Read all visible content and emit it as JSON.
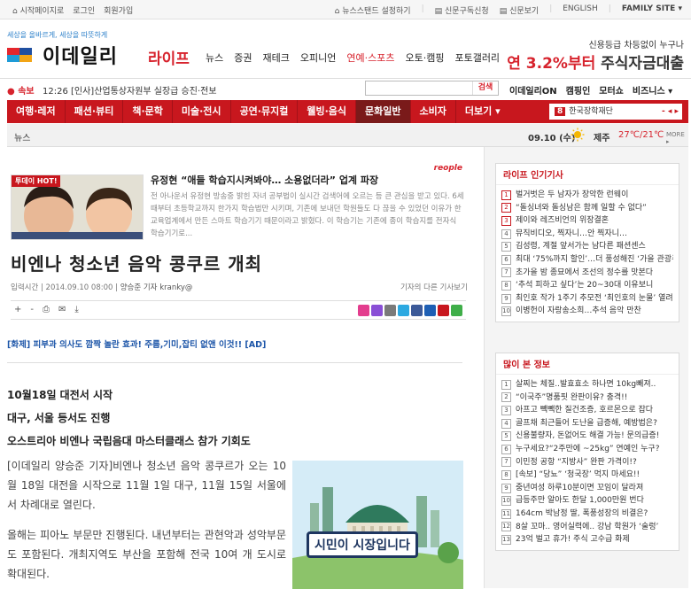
{
  "topbar": {
    "home": "시작페이지로",
    "login": "로그인",
    "join": "회원가입",
    "newsstand": "뉴스스탠드 설정하기",
    "subscribe": "신문구독신청",
    "paper": "신문보기",
    "english": "ENGLISH",
    "family": "FAMILY SITE"
  },
  "header": {
    "slogan": "세상을 올바르게, 세상을 따뜻하게",
    "logo": "이데일리",
    "section": "라이프",
    "nav": [
      "뉴스",
      "증권",
      "재테크",
      "오피니언",
      "연예·스포츠",
      "오토·캠핑",
      "포토갤러리"
    ],
    "ad_line1": "신용등급 차등없이 누구나",
    "ad_line2a": "연 3.2%부터",
    "ad_line2b": " 주식자금대출"
  },
  "ticker": {
    "tag": "속보",
    "text": "12:26 [인사]산업통상자원부 실장급 승진·전보",
    "search_placeholder": "",
    "search_btn": "검색",
    "links": [
      "이데일리ON",
      "캠핑인",
      "모터쇼",
      "비즈니스"
    ]
  },
  "categories": [
    "여행·레저",
    "패션·뷰티",
    "책·문학",
    "미술·전시",
    "공연·뮤지컬",
    "웰빙·음식",
    "문화일반",
    "소비자"
  ],
  "categories_more": "더보기",
  "rank_num": "8",
  "rank_text": "한국장학재단",
  "rank_ctl": "- ◂ ▸",
  "subbar": {
    "crumb": "뉴스",
    "date": "09.10 (수)",
    "city": "제주",
    "temp": "27℃/21℃",
    "more": "MORE ▸"
  },
  "hot": {
    "label": "투데이 HOT!",
    "headline": "유정현 “애들 학습지시켜봐야… 소용없더라” 업계 파장",
    "summary": "전 아나운서 유정현 방송중 밝힌 자녀 공부법이 실시간 검색어에 오르는 등 큰 관심을 받고 있다. 6세 때부터 초등학교까지 한가지 학습법만 시키며, 기존에 보내던 학원들도 다 끊을 수 있었던 이유가 한 교육업계에서 만든 스마트 학습기기 때문이라고 밝혔다. 이 학습기는 기존에 종이 학습지를 전자식 학습기기로...",
    "brand": "reople"
  },
  "article": {
    "title": "비엔나 청소년 음악 콩쿠르 개최",
    "meta": "입력시간 | 2014.09.10 08:00 | ",
    "author": "양승준 기자 kranky@",
    "other": "기자의 다른 기사보기",
    "tools": [
      "+",
      "-",
      "⎙",
      "✉",
      "⤓"
    ],
    "ad": "[화제] 피부과 의사도 깜짝 놀란 효과! 주름,기미,잡티 없앤 이것!! [AD]",
    "subheads": [
      "10월18일 대전서 시작",
      "대구, 서울 등서도 진행",
      "오스트리아 비엔나 국립음대 마스터클래스 참가 기회도"
    ],
    "p1": "[이데일리 양승준 기자]비엔나 청소년 음악 콩쿠르가 오는 10월 18일 대전을 시작으로 11월 1일 대구, 11월 15일 서울에서 차례대로 열린다.",
    "p2": "올해는 피아노 부문만 진행된다. 내년부터는 관현악과 성악부문도 포함된다. 개최지역도 부산을 포함해 전국 10여 개 도시로 확대된다.",
    "illus_text": "시민이 시장입니다"
  },
  "popular": {
    "title": "라이프 인기기사",
    "items": [
      "벌거벗은 두 남자가 장악한 런웨이",
      "“돌싱녀와 돌싱남은 함께 일할 수 없다”",
      "제이와 레즈비언의 위장결혼",
      "뮤직비디오, 찍자니…안 찍자니…",
      "김성령, 계절 앞서가는 남다른 패션센스",
      "최대 ‘75%까지 할인’…더 풍성해진 ‘가을 관광주간’",
      "초가을 밤 종묘에서 조선의 정수를 맛본다",
      "‘추석 피하고 싶다’는 20~30대 이유보니",
      "최인호 작가 1주기 추모전 ‘최인호의 눈물’ 열려",
      "이병헌이 자랑송소희…추석 음악 만찬"
    ]
  },
  "mostviewed": {
    "title": "많이 본 정보",
    "items": [
      "살찌는 체질..발효효소 하나면 10kg빼져..",
      "“이국주”명품핏 완판이유? 충격!!",
      "아프고 빽빽한 질건조증, 호르몬으로 잡다",
      "골프채 최근들어 도난을 급증해, 예방법은?",
      "신용불량자, 돈없어도 해결 가능! 문의급증!",
      "누구세요?“2주만에 ~25kg” 연예인 누구?",
      "이민정 공항 “지방사” 완판 가격이!?",
      "[속보] “당뇨” ‘청국장’ 먹지 마세요!!",
      "중년여성 하루10분이면 꼬임이 달라져",
      "급등주만 알아도 한달 1,000만원 번다",
      "164cm 박남정 딸, 폭풍성장의 비결은?",
      "8살 꼬마.. 영어실력에.. 강남 학원가 ‘술렁’",
      "23억 벌고 휴가! 주식 고수급 화제"
    ]
  },
  "colors": {
    "brand_red": "#c8171e",
    "link_blue": "#1c55a8"
  }
}
